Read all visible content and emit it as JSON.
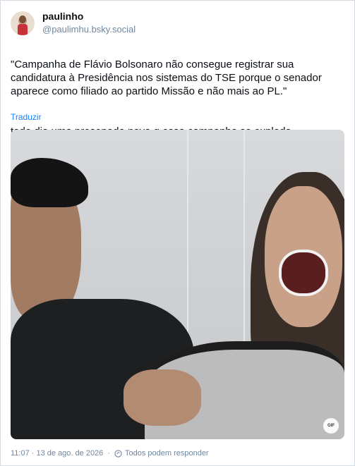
{
  "post": {
    "display_name": "paulinho",
    "handle": "@paulimhu.bsky.social",
    "text_paragraph_1": "\"Campanha de Flávio Bolsonaro não consegue registrar sua candidatura à Presidência nos sistemas do TSE porque o senador aparece como filiado ao partido Missão e não mais ao PL.\"",
    "text_paragraph_2": "todo dia uma presepada nova q essa campanha se exploda",
    "translate_label": "Traduzir",
    "media_badge": "GIF",
    "timestamp": "11:07 · 13 de ago. de 2026",
    "reply_setting": "Todos podem responder"
  },
  "icons": {
    "reply_setting_icon": "reply-restriction-icon"
  },
  "colors": {
    "link": "#1083fe",
    "muted": "#6f869f"
  }
}
